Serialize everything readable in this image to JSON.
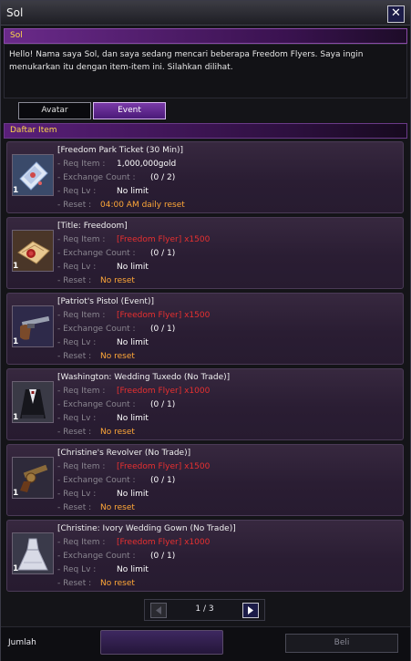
{
  "window": {
    "title": "Sol"
  },
  "npc": {
    "name": "Sol",
    "dialog": "Hello! Nama saya Sol, dan saya sedang mencari beberapa Freedom Flyers. Saya ingin menukarkan itu dengan item-item ini. Silahkan dilihat."
  },
  "tabs": [
    {
      "label": "Avatar"
    },
    {
      "label": "Event"
    }
  ],
  "list_header": "Daftar Item",
  "labels": {
    "req_item": "- Req Item :",
    "exchange_count": "- Exchange Count :",
    "req_lv": "- Req Lv :",
    "reset": "- Reset :"
  },
  "items": [
    {
      "name": "[Freedom Park Ticket (30 Min)]",
      "qty": "1",
      "req_item": "1,000,000gold",
      "exchange_count": "(0 / 2)",
      "req_lv": "No limit",
      "reset": "04:00 AM daily reset",
      "icon": "ticket-icon"
    },
    {
      "name": "[Title: Freedoom]",
      "qty": "1",
      "req_item": "[Freedom Flyer] x1500",
      "exchange_count": "(0 / 1)",
      "req_lv": "No limit",
      "reset": "No reset",
      "icon": "scroll-icon"
    },
    {
      "name": "[Patriot's Pistol (Event)]",
      "qty": "1",
      "req_item": "[Freedom Flyer] x1500",
      "exchange_count": "(0 / 1)",
      "req_lv": "No limit",
      "reset": "No reset",
      "icon": "pistol-icon"
    },
    {
      "name": "[Washington: Wedding Tuxedo (No Trade)]",
      "qty": "1",
      "req_item": "[Freedom Flyer] x1000",
      "exchange_count": "(0 / 1)",
      "req_lv": "No limit",
      "reset": "No reset",
      "icon": "tuxedo-icon"
    },
    {
      "name": "[Christine's Revolver (No Trade)]",
      "qty": "1",
      "req_item": "[Freedom Flyer] x1500",
      "exchange_count": "(0 / 1)",
      "req_lv": "No limit",
      "reset": "No reset",
      "icon": "revolver-icon"
    },
    {
      "name": "[Christine: Ivory Wedding Gown (No Trade)]",
      "qty": "1",
      "req_item": "[Freedom Flyer] x1000",
      "exchange_count": "(0 / 1)",
      "req_lv": "No limit",
      "reset": "No reset",
      "icon": "gown-icon"
    }
  ],
  "pagination": {
    "text": "1 / 3"
  },
  "footer": {
    "quantity_label": "Jumlah",
    "quantity_value": "",
    "buy_label": "Beli"
  },
  "colors": {
    "accent": "#7a3aa8",
    "header_text": "#ffd84a",
    "requirement_red": "#e83030",
    "reset_orange": "#ffa838"
  }
}
